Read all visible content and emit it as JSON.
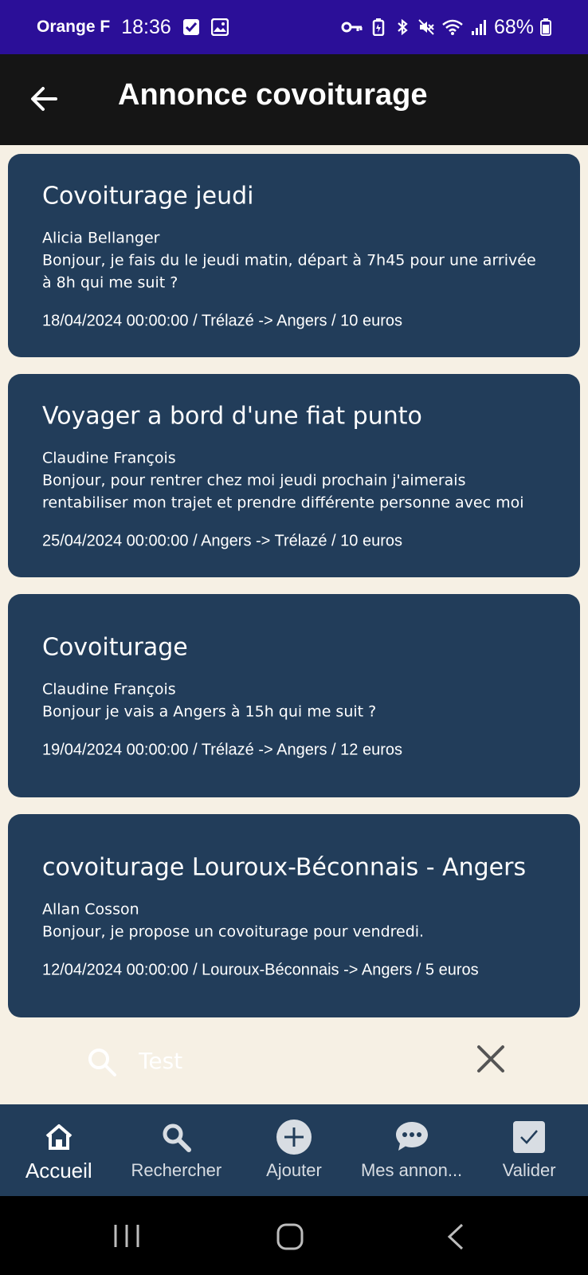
{
  "status_bar": {
    "carrier": "Orange F",
    "time": "18:36",
    "battery": "68%"
  },
  "app_bar": {
    "title": "Annonce covoiturage"
  },
  "listings": [
    {
      "title": "Covoiturage jeudi",
      "author": "Alicia Bellanger",
      "description": "Bonjour, je fais du le jeudi matin, départ à 7h45 pour une arrivée à 8h qui me suit ?",
      "meta": "18/04/2024 00:00:00 / Trélazé -> Angers / 10 euros"
    },
    {
      "title": "Voyager a bord d'une fiat punto",
      "author": "Claudine François",
      "description": "Bonjour, pour rentrer chez moi jeudi prochain j'aimerais rentabiliser mon trajet et prendre différente personne avec moi",
      "meta": "25/04/2024 00:00:00 / Angers -> Trélazé / 10 euros"
    },
    {
      "title": "Covoiturage",
      "author": "Claudine François",
      "description": "Bonjour je vais a Angers à 15h qui me suit ?",
      "meta": "19/04/2024 00:00:00 / Trélazé -> Angers / 12 euros"
    },
    {
      "title": "covoiturage Louroux-Béconnais - Angers",
      "author": "Allan Cosson",
      "description": "Bonjour, je propose un covoiturage pour vendredi.",
      "meta": "12/04/2024 00:00:00 / Louroux-Béconnais -> Angers / 5 euros"
    }
  ],
  "search": {
    "placeholder": "Test"
  },
  "bottom_nav": {
    "items": [
      {
        "label": "Accueil",
        "icon": "home-icon",
        "active": true
      },
      {
        "label": "Rechercher",
        "icon": "search-icon",
        "active": false
      },
      {
        "label": "Ajouter",
        "icon": "add-icon",
        "active": false
      },
      {
        "label": "Mes annon...",
        "icon": "chat-icon",
        "active": false
      },
      {
        "label": "Valider",
        "icon": "checkbox-icon",
        "active": false
      }
    ]
  },
  "colors": {
    "status_bar": "#2B0F98",
    "app_bar": "#151515",
    "card": "#223D5A",
    "background": "#F6F0E4"
  }
}
